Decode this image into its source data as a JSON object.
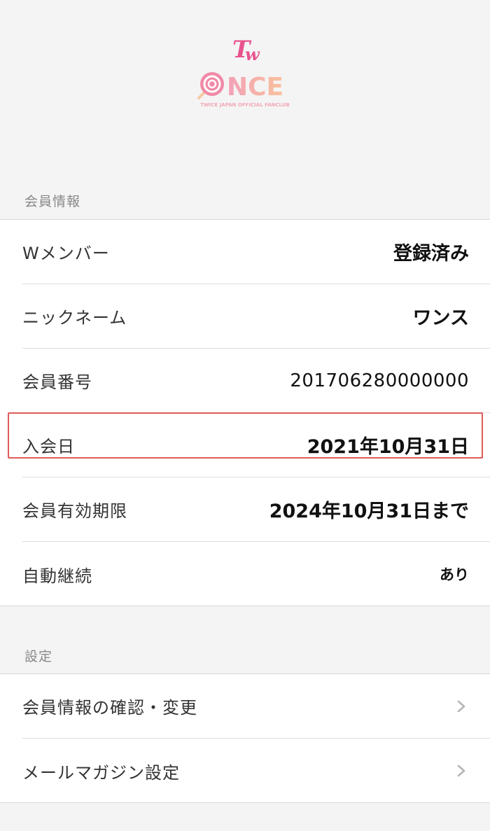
{
  "logo": {
    "letter": "Tw",
    "wordmark": "ONCE",
    "tagline": "TWICE JAPAN OFFICIAL FANCLUB",
    "colors": {
      "pink": "#e8538f",
      "peach": "#f6b28a",
      "light": "#f8c7a6"
    }
  },
  "member_info": {
    "header": "会員情報",
    "rows": [
      {
        "label": "Wメンバー",
        "value": "登録済み"
      },
      {
        "label": "ニックネーム",
        "value": "ワンス"
      },
      {
        "label": "会員番号",
        "value": "201706280000000"
      },
      {
        "label": "入会日",
        "value": "2021年10月31日"
      },
      {
        "label": "会員有効期限",
        "value": "2024年10月31日まで"
      },
      {
        "label": "自動継続",
        "value": "あり"
      }
    ]
  },
  "settings": {
    "header": "設定",
    "items": [
      {
        "label": "会員情報の確認・変更",
        "icon": "chevron-right-icon"
      },
      {
        "label": "メールマガジン設定",
        "icon": "chevron-right-icon"
      }
    ]
  },
  "colors": {
    "background": "#f5f4f4",
    "highlight_border": "#e05a5a"
  }
}
